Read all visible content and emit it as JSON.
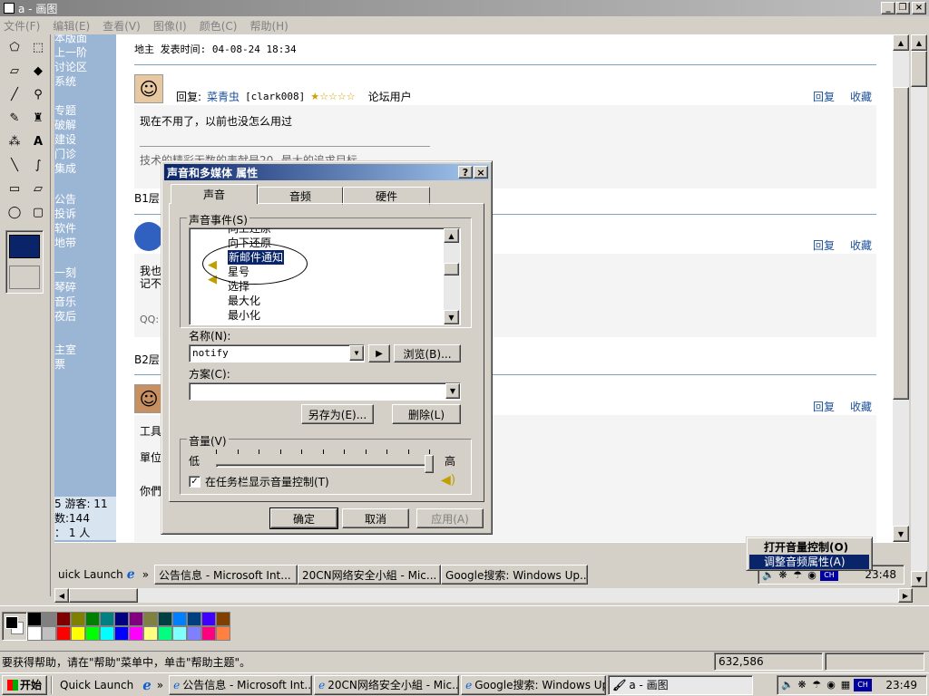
{
  "window": {
    "title": "a - 画图"
  },
  "menu": [
    "文件(F)",
    "编辑(E)",
    "查看(V)",
    "图像(I)",
    "颜色(C)",
    "帮助(H)"
  ],
  "web": {
    "side_top": [
      "本版面",
      "上一阶",
      "讨论区",
      "系统"
    ],
    "side_mid": [
      "专题",
      "破解",
      "建设",
      "门诊",
      "集成"
    ],
    "side_low": [
      "公告",
      "投诉",
      "软件",
      "地带"
    ],
    "side_low2": [
      "一刻",
      "琴碎",
      "音乐",
      "夜后"
    ],
    "side_low3": [
      "主室",
      "票"
    ],
    "side_stats": [
      "5 游客: 11",
      "数:144",
      "： 1 人"
    ],
    "post0_header": "地主 发表时间: 04-08-24 18:34",
    "post1_reply": "回复:",
    "post1_user": "菜青虫",
    "post1_id": "[clark008]",
    "post1_stars": "★☆☆☆☆",
    "post1_role": "论坛用户",
    "reply_link": "回复",
    "fav_link": "收藏",
    "post1_body": "现在不用了，以前也没怎么用过",
    "post1_sig": "技术的精彩无数的表献是20--最大的追求目标",
    "floor1": "B1层",
    "post2_body1": "我也",
    "post2_body2": "记不",
    "post2_qq": "QQ:",
    "floor2": "B2层",
    "post3_body1": "工具",
    "post3_body2": "單位",
    "post3_body3": "你們"
  },
  "dialog": {
    "title": "声音和多媒体 属性",
    "help": "?",
    "close": "×",
    "tabs": [
      "声音",
      "音频",
      "硬件"
    ],
    "events_label": "声音事件(S)",
    "events": [
      "向上还原",
      "向下还原",
      "新邮件通知",
      "星号",
      "选择",
      "最大化",
      "最小化"
    ],
    "selected_event": "新邮件通知",
    "name_label": "名称(N):",
    "name_value": "notify",
    "browse": "浏览(B)...",
    "scheme_label": "方案(C):",
    "scheme_value": "",
    "save_as": "另存为(E)...",
    "delete": "删除(L)",
    "volume_label": "音量(V)",
    "low": "低",
    "high": "高",
    "volume_level": 1.0,
    "show_tray": "在任务栏显示音量控制(T)",
    "show_tray_checked": true,
    "ok": "确定",
    "cancel": "取消",
    "apply": "应用(A)"
  },
  "context_menu": {
    "item1": "打开音量控制(O)",
    "item2": "调整音频属性(A)"
  },
  "inner_taskbar": {
    "quick_launch": "uick Launch",
    "chevron": "»",
    "items": [
      "公告信息 - Microsoft Int...",
      "20CN网络安全小組 - Mic...",
      "Google搜索: Windows Up..."
    ],
    "clock": "23:48",
    "lang": "CH"
  },
  "status": {
    "help_text": "要获得帮助，请在\"帮助\"菜单中，单击\"帮助主题\"。",
    "coords": "632,586"
  },
  "taskbar": {
    "start": "开始",
    "quick_launch": "Quick Launch",
    "chevron": "»",
    "items": [
      "公告信息 - Microsoft Int...",
      "20CN网络安全小組 - Mic...",
      "Google搜索: Windows Up...",
      "a - 画图"
    ],
    "lang": "CH",
    "clock": "23:49"
  },
  "colors": {
    "palette_top": [
      "#000000",
      "#808080",
      "#800000",
      "#808000",
      "#008000",
      "#008080",
      "#000080",
      "#800080",
      "#808040",
      "#004040",
      "#0080ff",
      "#004080",
      "#4000ff",
      "#804000"
    ],
    "palette_bottom": [
      "#ffffff",
      "#c0c0c0",
      "#ff0000",
      "#ffff00",
      "#00ff00",
      "#00ffff",
      "#0000ff",
      "#ff00ff",
      "#ffff80",
      "#00ff80",
      "#80ffff",
      "#8080ff",
      "#ff0080",
      "#ff8040"
    ],
    "title_active": "#0a246a"
  }
}
